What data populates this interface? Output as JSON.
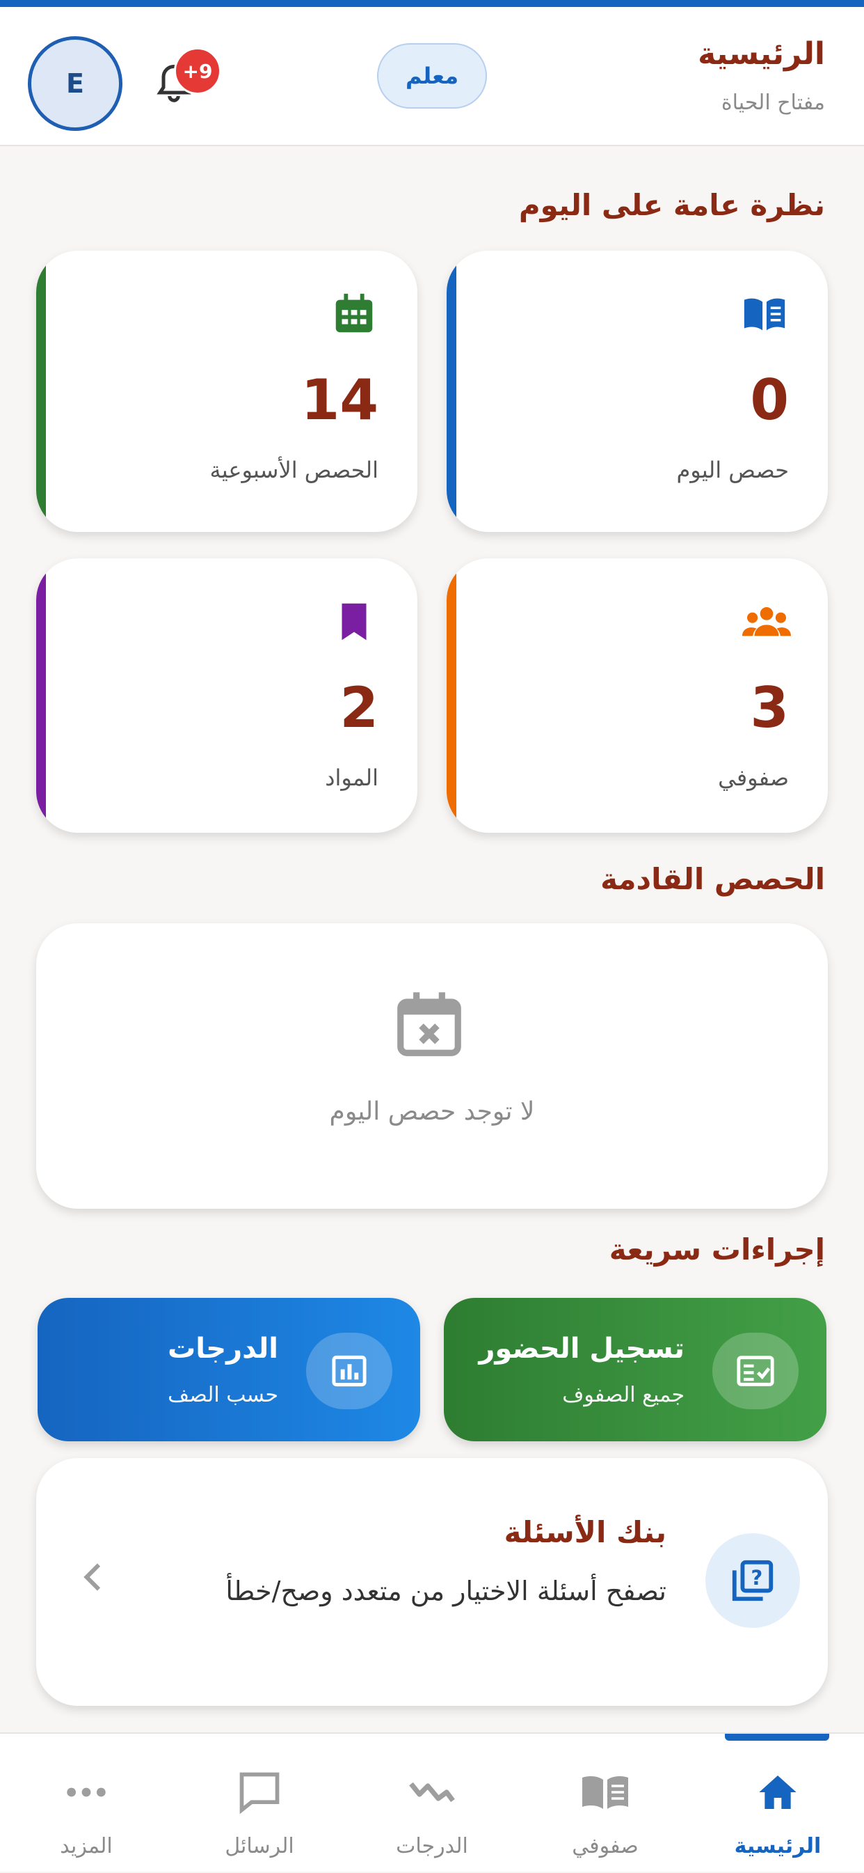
{
  "header": {
    "title": "الرئيسية",
    "subtitle": "مفتاح الحياة",
    "role_badge": "معلم",
    "notification_count": "+9",
    "avatar_initial": "E"
  },
  "overview": {
    "title": "نظرة عامة على اليوم",
    "cards": [
      {
        "value": "0",
        "label": "حصص اليوم",
        "icon": "open-book-icon",
        "color": "#1565C0"
      },
      {
        "value": "14",
        "label": "الحصص الأسبوعية",
        "icon": "calendar-icon",
        "color": "#2E7D32"
      },
      {
        "value": "3",
        "label": "صفوفي",
        "icon": "group-icon",
        "color": "#EF6C00"
      },
      {
        "value": "2",
        "label": "المواد",
        "icon": "bookmark-icon",
        "color": "#7B1FA2"
      }
    ]
  },
  "upcoming": {
    "title": "الحصص القادمة",
    "empty_text": "لا توجد حصص اليوم",
    "icon": "calendar-x-icon"
  },
  "quick_actions": {
    "title": "إجراءات سريعة",
    "attendance": {
      "title": "تسجيل الحضور",
      "subtitle": "جميع الصفوف",
      "icon": "checklist-icon"
    },
    "grades": {
      "title": "الدرجات",
      "subtitle": "حسب الصف",
      "icon": "bar-chart-icon"
    }
  },
  "question_bank": {
    "title": "بنك الأسئلة",
    "description": "تصفح أسئلة الاختيار من متعدد وصح/خطأ",
    "icon": "question-library-icon"
  },
  "bottom_nav": {
    "items": [
      {
        "label": "الرئيسية",
        "icon": "home-icon",
        "active": true
      },
      {
        "label": "صفوفي",
        "icon": "open-book-icon",
        "active": false
      },
      {
        "label": "الدرجات",
        "icon": "trend-icon",
        "active": false
      },
      {
        "label": "الرسائل",
        "icon": "message-icon",
        "active": false
      },
      {
        "label": "المزيد",
        "icon": "more-icon",
        "active": false
      }
    ]
  },
  "colors": {
    "primary": "#1565C0",
    "title": "#8B2A14",
    "green": "#2E7D32",
    "orange": "#EF6C00",
    "purple": "#7B1FA2"
  }
}
